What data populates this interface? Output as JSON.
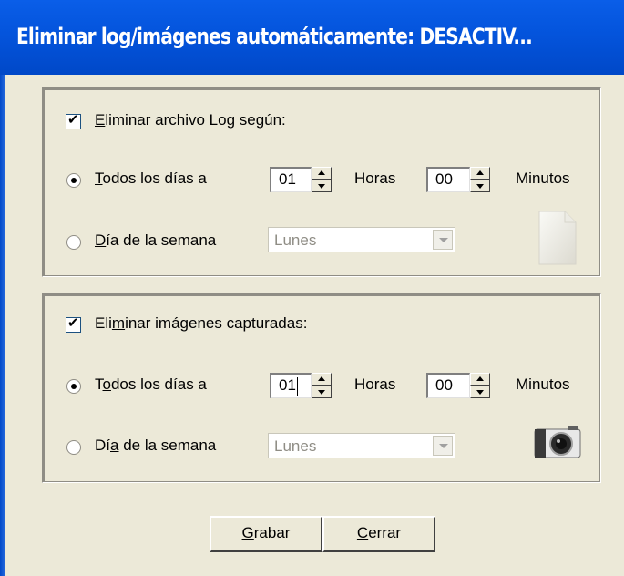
{
  "window": {
    "title": "Eliminar log/imágenes automáticamente: DESACTIV..."
  },
  "log_group": {
    "checkbox_label": "Eliminar archivo Log según:",
    "checked": true,
    "daily_label": "Todos los días a",
    "hours_value": "01",
    "hours_label": "Horas",
    "minutes_value": "00",
    "minutes_label": "Minutos",
    "weekday_label": "Día de la semana",
    "weekday_value": "Lunes",
    "icon": "document-icon"
  },
  "image_group": {
    "checkbox_label": "Eliminar imágenes capturadas:",
    "checked": true,
    "daily_label": "Todos los días a",
    "hours_value": "01",
    "hours_label": "Horas",
    "minutes_value": "00",
    "minutes_label": "Minutos",
    "weekday_label": "Día de la semana",
    "weekday_value": "Lunes",
    "icon": "camera-icon"
  },
  "buttons": {
    "save": "Grabar",
    "close": "Cerrar"
  }
}
